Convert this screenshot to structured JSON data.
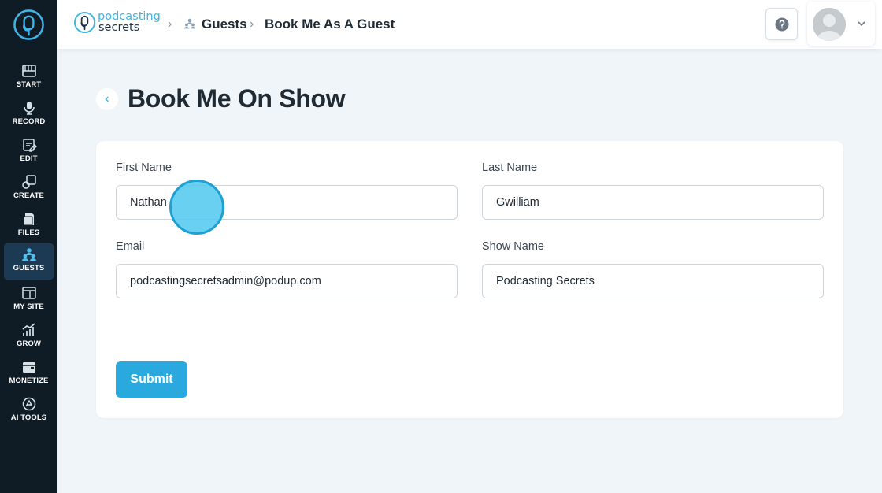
{
  "sidebar": {
    "items": [
      {
        "label": "START",
        "icon": "keyboard-icon"
      },
      {
        "label": "RECORD",
        "icon": "microphone-icon"
      },
      {
        "label": "EDIT",
        "icon": "edit-icon"
      },
      {
        "label": "CREATE",
        "icon": "create-icon"
      },
      {
        "label": "FILES",
        "icon": "files-icon"
      },
      {
        "label": "GUESTS",
        "icon": "guests-icon",
        "active": true
      },
      {
        "label": "MY SITE",
        "icon": "site-icon"
      },
      {
        "label": "GROW",
        "icon": "chart-icon"
      },
      {
        "label": "MONETIZE",
        "icon": "monetize-icon"
      },
      {
        "label": "AI TOOLS",
        "icon": "ai-tools-icon"
      }
    ]
  },
  "header": {
    "brand_line1": "podcasting",
    "brand_line2": "secrets",
    "breadcrumb": {
      "section": "Guests",
      "current": "Book Me As A Guest"
    },
    "help_icon": "help-icon"
  },
  "main": {
    "title": "Book Me On Show",
    "form": {
      "first_name": {
        "label": "First Name",
        "value": "Nathan"
      },
      "last_name": {
        "label": "Last Name",
        "value": "Gwilliam"
      },
      "email": {
        "label": "Email",
        "value": "podcastingsecretsadmin@podup.com"
      },
      "show_name": {
        "label": "Show Name",
        "value": "Podcasting Secrets"
      },
      "submit_label": "Submit"
    }
  },
  "colors": {
    "sidebar_bg": "#0f1c26",
    "accent": "#29a9de",
    "page_bg": "#f0f5f9"
  }
}
